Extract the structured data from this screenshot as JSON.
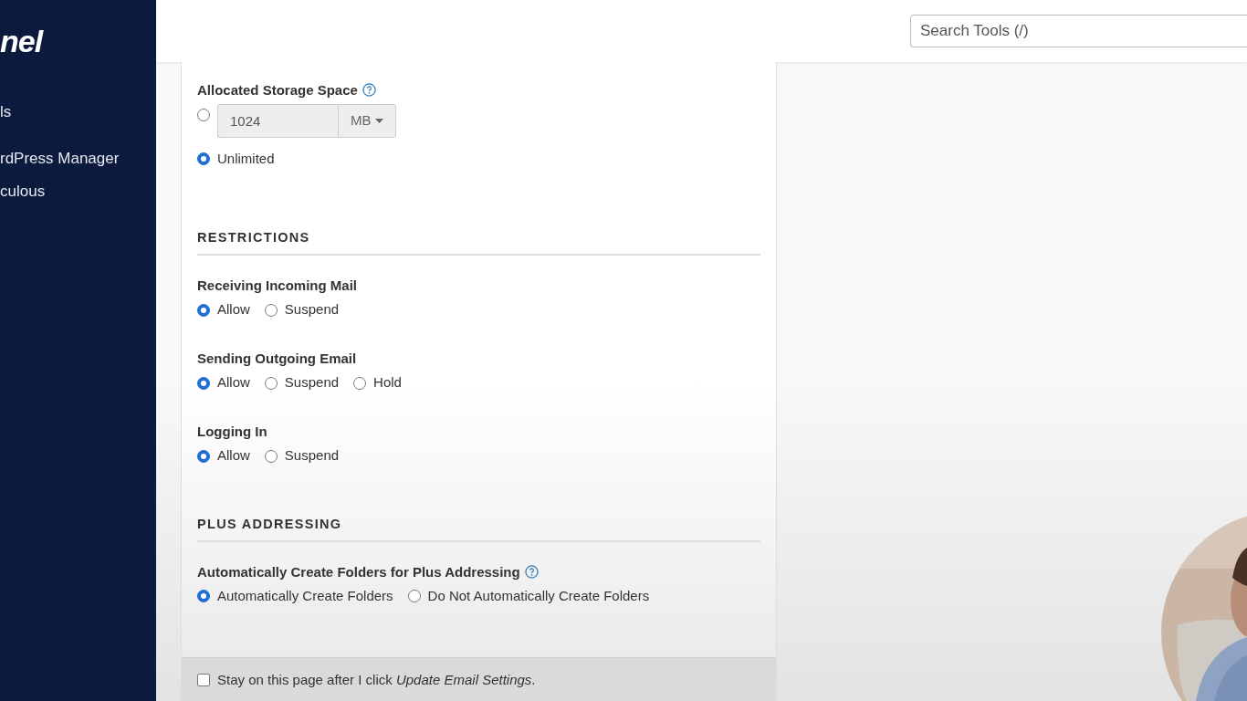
{
  "sidebar": {
    "logo": "nel",
    "items": [
      {
        "label": "ls"
      },
      {
        "label": "rdPress Manager"
      },
      {
        "label": "culous"
      }
    ]
  },
  "search": {
    "placeholder": "Search Tools (/)"
  },
  "storage": {
    "label": "Allocated Storage Space",
    "help": true,
    "options": [
      {
        "kind": "quota",
        "value": "1024",
        "unit": "MB",
        "selected": false
      },
      {
        "kind": "plain",
        "label": "Unlimited",
        "selected": true
      }
    ]
  },
  "sections": [
    {
      "title": "RESTRICTIONS",
      "groups": [
        {
          "label": "Receiving Incoming Mail",
          "help": false,
          "options": [
            {
              "label": "Allow",
              "selected": true
            },
            {
              "label": "Suspend",
              "selected": false
            }
          ]
        },
        {
          "label": "Sending Outgoing Email",
          "help": false,
          "options": [
            {
              "label": "Allow",
              "selected": true
            },
            {
              "label": "Suspend",
              "selected": false
            },
            {
              "label": "Hold",
              "selected": false
            }
          ]
        },
        {
          "label": "Logging In",
          "help": false,
          "options": [
            {
              "label": "Allow",
              "selected": true
            },
            {
              "label": "Suspend",
              "selected": false
            }
          ]
        }
      ]
    },
    {
      "title": "PLUS ADDRESSING",
      "groups": [
        {
          "label": "Automatically Create Folders for Plus Addressing",
          "help": true,
          "options": [
            {
              "label": "Automatically Create Folders",
              "selected": true
            },
            {
              "label": "Do Not Automatically Create Folders",
              "selected": false
            }
          ]
        }
      ]
    }
  ],
  "footer": {
    "label": "Stay on this page after I click *Update Email Settings*.",
    "checked": false
  }
}
